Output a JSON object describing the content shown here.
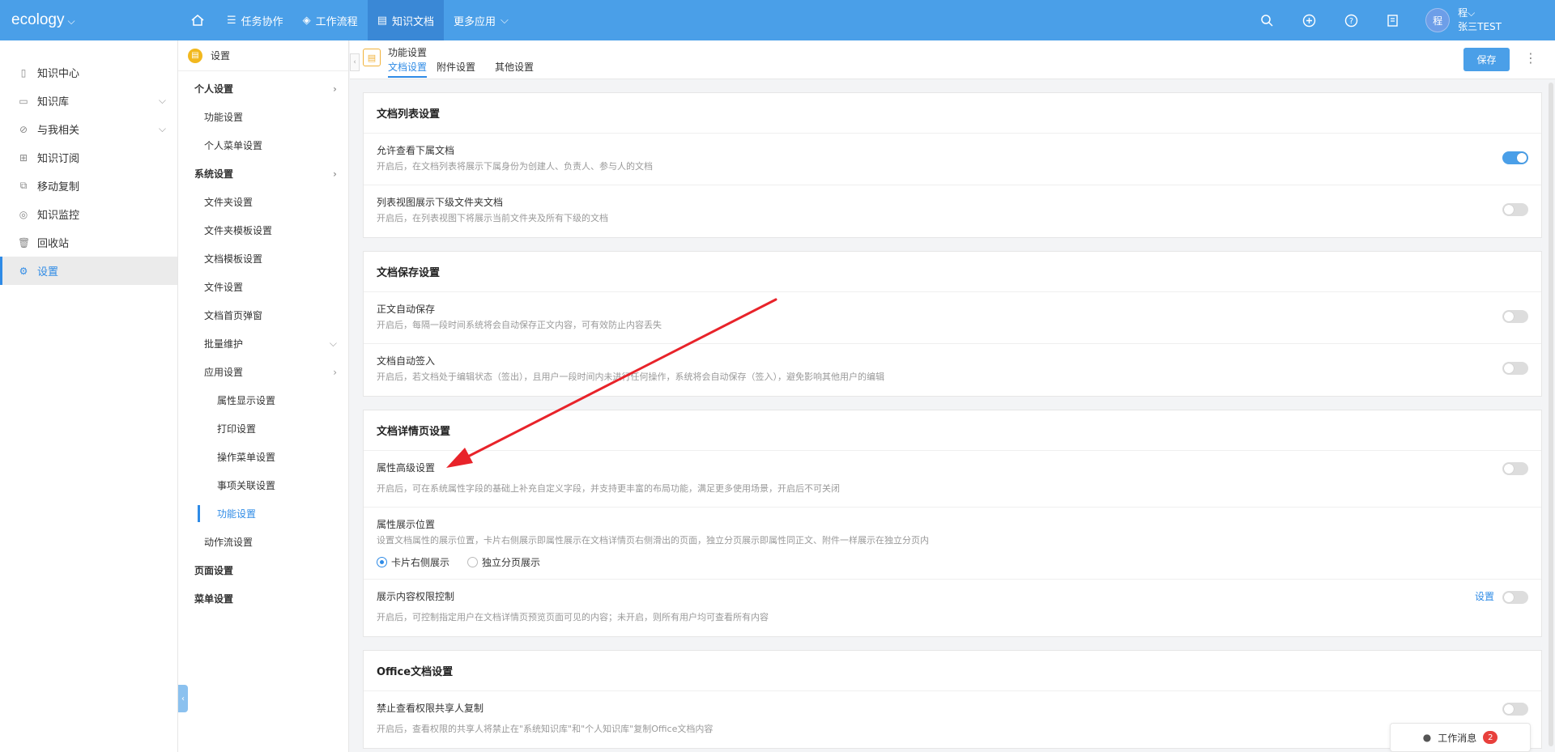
{
  "app": {
    "logo": "ecology"
  },
  "topnav": {
    "items": [
      {
        "label": "任务协作",
        "icon": "list-icon"
      },
      {
        "label": "工作流程",
        "icon": "layers-icon"
      },
      {
        "label": "知识文档",
        "icon": "document-icon"
      },
      {
        "label": "更多应用",
        "icon": "chevron-down-icon"
      }
    ],
    "active_index": 2
  },
  "user": {
    "avatar_char": "程",
    "title": "程",
    "name": "张三TEST"
  },
  "sidebar": {
    "items": [
      {
        "label": "知识中心",
        "icon": "file-icon"
      },
      {
        "label": "知识库",
        "icon": "library-icon"
      },
      {
        "label": "与我相关",
        "icon": "link-icon"
      },
      {
        "label": "知识订阅",
        "icon": "subscribe-icon"
      },
      {
        "label": "移动复制",
        "icon": "copy-icon"
      },
      {
        "label": "知识监控",
        "icon": "monitor-icon"
      },
      {
        "label": "回收站",
        "icon": "trash-icon"
      },
      {
        "label": "设置",
        "icon": "gear-icon"
      }
    ],
    "active_index": 7
  },
  "panel2": {
    "title": "设置",
    "items": [
      {
        "label": "个人设置",
        "level": 1
      },
      {
        "label": "功能设置",
        "level": 2
      },
      {
        "label": "个人菜单设置",
        "level": 2
      },
      {
        "label": "系统设置",
        "level": 1
      },
      {
        "label": "文件夹设置",
        "level": 2
      },
      {
        "label": "文件夹模板设置",
        "level": 2
      },
      {
        "label": "文档模板设置",
        "level": 2
      },
      {
        "label": "文件设置",
        "level": 2
      },
      {
        "label": "文档首页弹窗",
        "level": 2
      },
      {
        "label": "批量维护",
        "level": 2
      },
      {
        "label": "应用设置",
        "level": 2
      },
      {
        "label": "属性显示设置",
        "level": 3
      },
      {
        "label": "打印设置",
        "level": 3
      },
      {
        "label": "操作菜单设置",
        "level": 3
      },
      {
        "label": "事项关联设置",
        "level": 3
      },
      {
        "label": "功能设置",
        "level": 3
      },
      {
        "label": "动作流设置",
        "level": 2
      },
      {
        "label": "页面设置",
        "level": 1
      },
      {
        "label": "菜单设置",
        "level": 1
      }
    ]
  },
  "header": {
    "title": "功能设置",
    "tabs": [
      "文档设置",
      "附件设置",
      "其他设置"
    ],
    "active_tab": 0,
    "save_label": "保存"
  },
  "sections": {
    "list": {
      "title": "文档列表设置",
      "rows": [
        {
          "name": "允许查看下属文档",
          "desc": "开启后，在文档列表将展示下属身份为创建人、负责人、参与人的文档",
          "on": true
        },
        {
          "name": "列表视图展示下级文件夹文档",
          "desc": "开启后，在列表视图下将展示当前文件夹及所有下级的文档",
          "on": false
        }
      ]
    },
    "save": {
      "title": "文档保存设置",
      "rows": [
        {
          "name": "正文自动保存",
          "desc": "开启后，每隔一段时间系统将会自动保存正文内容，可有效防止内容丢失",
          "on": false
        },
        {
          "name": "文档自动签入",
          "desc": "开启后，若文档处于编辑状态（签出），且用户一段时间内未进行任何操作，系统将会自动保存（签入），避免影响其他用户的编辑",
          "on": false
        }
      ]
    },
    "detail": {
      "title": "文档详情页设置",
      "adv_name": "属性高级设置",
      "adv_desc": "开启后，可在系统属性字段的基础上补充自定义字段，并支持更丰富的布局功能，满足更多使用场景，开启后不可关闭",
      "pos_name": "属性展示位置",
      "pos_desc": "设置文档属性的展示位置，卡片右侧展示即属性展示在文档详情页右侧滑出的页面，独立分页展示即属性同正文、附件一样展示在独立分页内",
      "pos_options": [
        "卡片右侧展示",
        "独立分页展示"
      ],
      "pos_selected": 0,
      "perm_name": "展示内容权限控制",
      "perm_desc": "开启后，可控制指定用户在文档详情页预览页面可见的内容；未开启，则所有用户均可查看所有内容",
      "perm_link": "设置"
    },
    "office": {
      "title": "Office文档设置",
      "row_name": "禁止查看权限共享人复制",
      "row_desc": "开启后，查看权限的共享人将禁止在\"系统知识库\"和\"个人知识库\"复制Office文档内容"
    }
  },
  "messages": {
    "label": "工作消息",
    "count": "2"
  },
  "colors": {
    "topbar": "#4a9fe8",
    "accent": "#2f8be6",
    "annotation_arrow": "#e8232a"
  }
}
